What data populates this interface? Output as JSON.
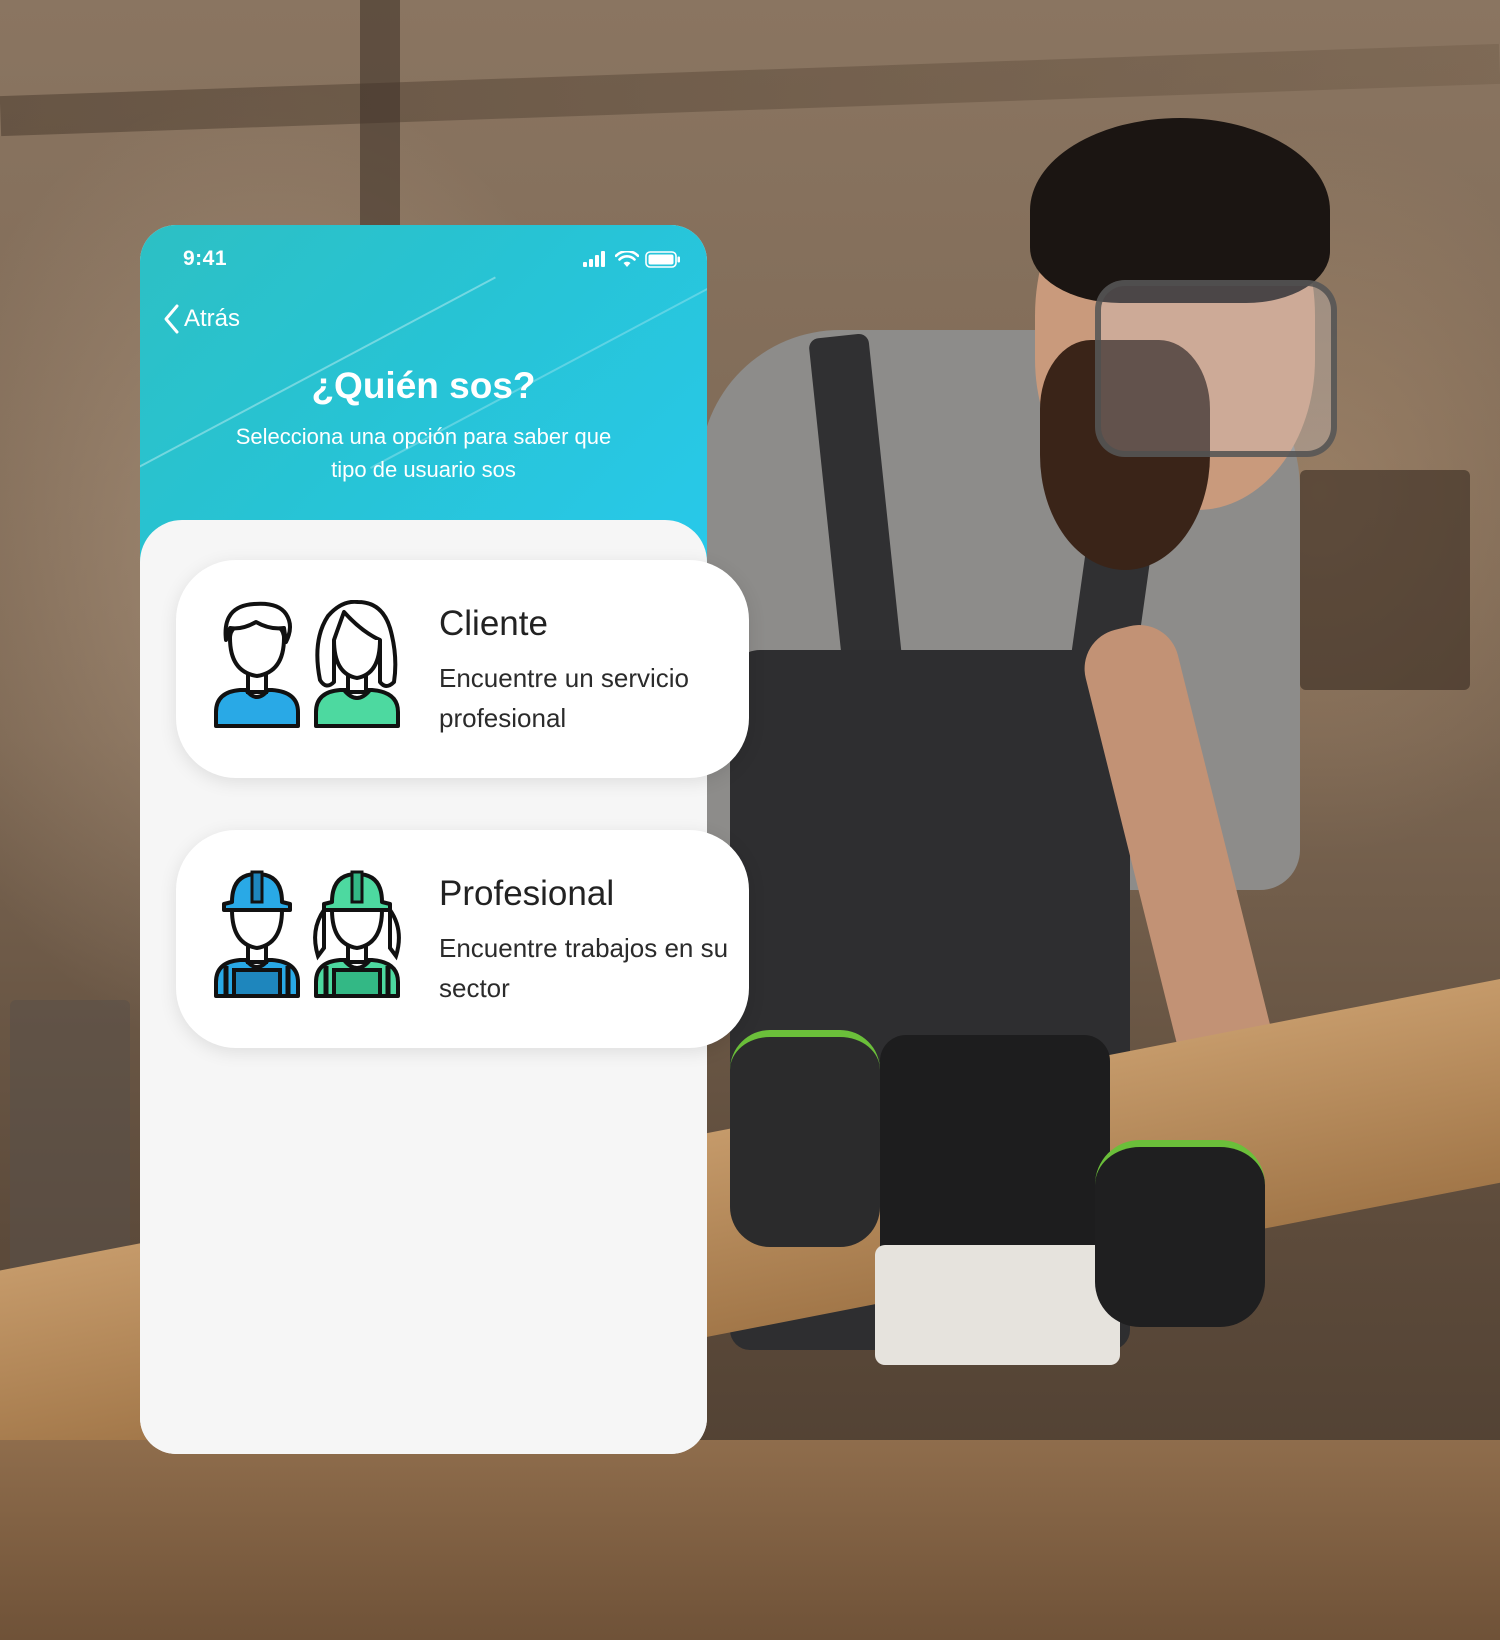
{
  "status_bar": {
    "time": "9:41",
    "icons": [
      "signal-icon",
      "wifi-icon",
      "battery-icon"
    ]
  },
  "header": {
    "back_label": "Atrás",
    "title": "¿Quién sos?",
    "subtitle": "Selecciona una opción para saber que tipo de usuario sos"
  },
  "options": [
    {
      "title": "Cliente",
      "description": "Encuentre un servicio profesional",
      "icon": "client-avatars-icon"
    },
    {
      "title": "Profesional",
      "description": "Encuentre trabajos en su sector",
      "icon": "professional-avatars-icon"
    }
  ],
  "colors": {
    "header_start": "#2dc0c4",
    "header_end": "#28c9ea",
    "avatar_blue": "#29a9e6",
    "avatar_green": "#4dd9a0",
    "card_bg": "#ffffff",
    "sheet_bg": "#f6f6f6"
  }
}
